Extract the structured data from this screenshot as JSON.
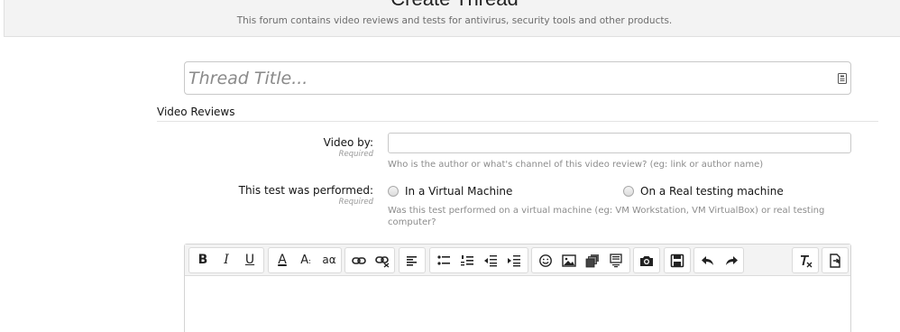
{
  "header": {
    "title": "Create Thread",
    "description": "This forum contains video reviews and tests for antivirus, security tools and other products."
  },
  "thread_title": {
    "placeholder": "Thread Title...",
    "value": ""
  },
  "section": {
    "title": "Video Reviews"
  },
  "video_by": {
    "label": "Video by:",
    "required": "Required",
    "value": "",
    "explain": "Who is the author or what's channel of this video review? (eg: link or author name)"
  },
  "test_performed": {
    "label": "This test was performed:",
    "required": "Required",
    "options": [
      "In a Virtual Machine",
      "On a Real testing machine"
    ],
    "selected": null,
    "explain_line1": "Was this test performed on a virtual machine (eg: VM Workstation, VM VirtualBox) or real testing",
    "explain_line2": "computer?"
  },
  "toolbar": {
    "bold": "B",
    "italic": "I",
    "underline": "U",
    "font_color": "A",
    "font_size": "A",
    "font_family": "a",
    "icons": [
      "bold-icon",
      "italic-icon",
      "underline-icon",
      "font-color-icon",
      "font-size-icon",
      "font-family-icon",
      "link-icon",
      "unlink-icon",
      "align-icon",
      "bullet-list-icon",
      "numbered-list-icon",
      "outdent-icon",
      "indent-icon",
      "smilie-icon",
      "image-icon",
      "media-icon",
      "insert-quote-icon",
      "camera-icon",
      "save-draft-icon",
      "undo-icon",
      "redo-icon",
      "remove-format-icon",
      "toggle-bbcode-icon"
    ]
  },
  "colors": {
    "header_bg": "#f3f3f3",
    "toolbar_bg": "#f3f3f3",
    "hint": "#8c8c8c",
    "border": "#c8c8c8"
  }
}
